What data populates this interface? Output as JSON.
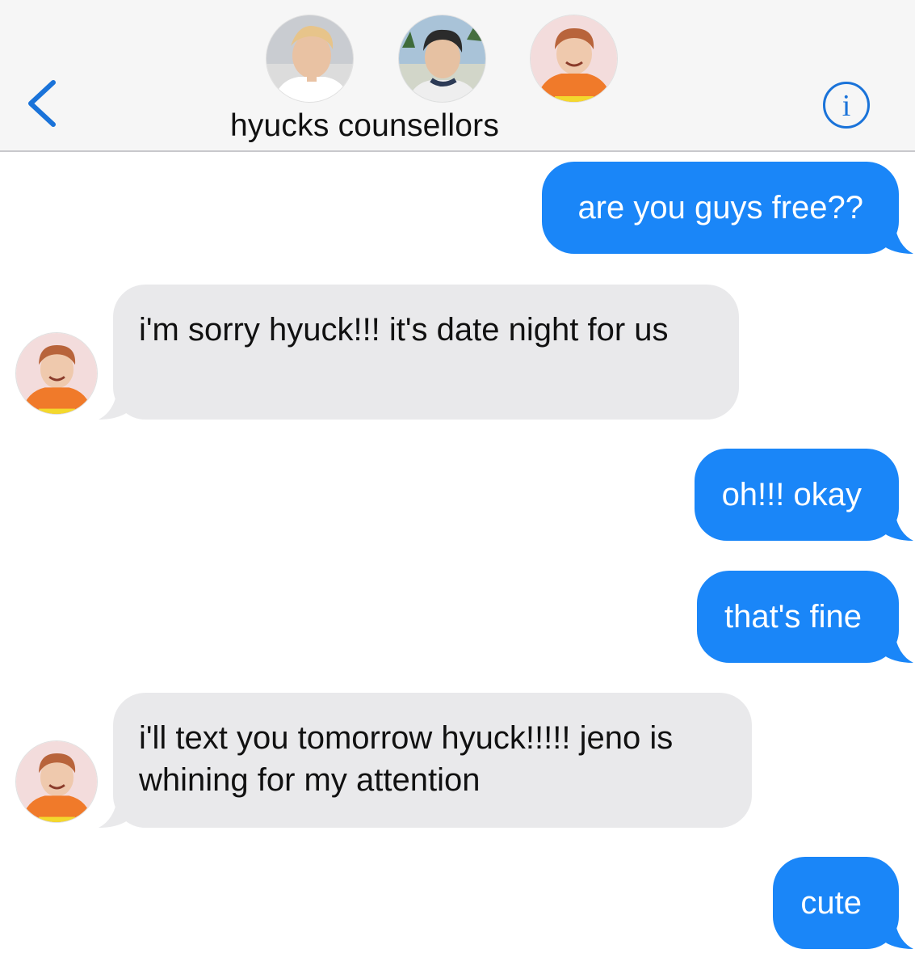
{
  "header": {
    "back_icon": "chevron-left-icon",
    "group_name": "hyucks counsellors",
    "info_icon": "info-circle-icon",
    "accent_color": "#1a73d9",
    "participants": [
      {
        "avatar": "avatar-person-white-shirt"
      },
      {
        "avatar": "avatar-person-outdoors"
      },
      {
        "avatar": "avatar-person-orange-hoodie"
      }
    ]
  },
  "messages": [
    {
      "direction": "sent",
      "text": "are you guys free??"
    },
    {
      "direction": "received",
      "text": "i'm sorry hyuck!!! it's date night for us"
    },
    {
      "direction": "sent",
      "text": "oh!!! okay"
    },
    {
      "direction": "sent",
      "text": "that's fine"
    },
    {
      "direction": "received",
      "text": "i'll text you tomorrow hyuck!!!!! jeno is whining for my attention"
    },
    {
      "direction": "sent",
      "text": "cute"
    }
  ],
  "colors": {
    "sent_bubble": "#1a86f8",
    "received_bubble": "#e9e9eb",
    "header_bg": "#f6f6f6"
  }
}
